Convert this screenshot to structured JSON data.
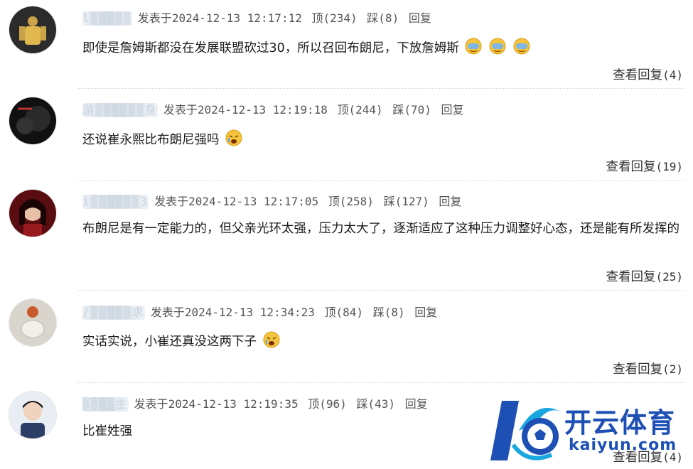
{
  "comments": [
    {
      "username": "l▒▒▒▒▒",
      "posted_label": "发表于",
      "timestamp": "2024-12-13 12:17:12",
      "upvote": "顶(234)",
      "downvote": "踩(8)",
      "reply_label": "回复",
      "text": "即使是詹姆斯都没在发展联盟砍过30，所以召回布朗尼，下放詹姆斯",
      "view_replies": "查看回复",
      "view_count": "(4)"
    },
    {
      "username": "游▒▒▒▒▒▒身",
      "posted_label": "发表于",
      "timestamp": "2024-12-13 12:19:18",
      "upvote": "顶(244)",
      "downvote": "踩(70)",
      "reply_label": "回复",
      "text": "还说崔永熙比布朗尼强吗",
      "view_replies": "查看回复",
      "view_count": "(19)"
    },
    {
      "username": "i▒▒▒▒▒▒3",
      "posted_label": "发表于",
      "timestamp": "2024-12-13 12:17:05",
      "upvote": "顶(258)",
      "downvote": "踩(127)",
      "reply_label": "回复",
      "text": "布朗尼是有一定能力的，但父亲光环太强，压力太大了，逐渐适应了这种压力调整好心态，还是能有所发挥的",
      "view_replies": "查看回复",
      "view_count": "(25)"
    },
    {
      "username": "/▒▒▒▒▒求",
      "posted_label": "发表于",
      "timestamp": "2024-12-13 12:34:23",
      "upvote": "顶(84)",
      "downvote": "踩(8)",
      "reply_label": "回复",
      "text": "实话实说，小崔还真没这两下子",
      "view_replies": "查看回复",
      "view_count": "(2)"
    },
    {
      "username": "▒▒▒▒主",
      "posted_label": "发表于",
      "timestamp": "2024-12-13 12:19:35",
      "upvote": "顶(96)",
      "downvote": "踩(43)",
      "reply_label": "回复",
      "text": "比崔姓强",
      "view_replies": "查看回复",
      "view_count": "(4)"
    }
  ],
  "watermark": {
    "brand_cn": "开云体育",
    "brand_url": "kaiyun.com",
    "color": "#1d4fb5"
  }
}
